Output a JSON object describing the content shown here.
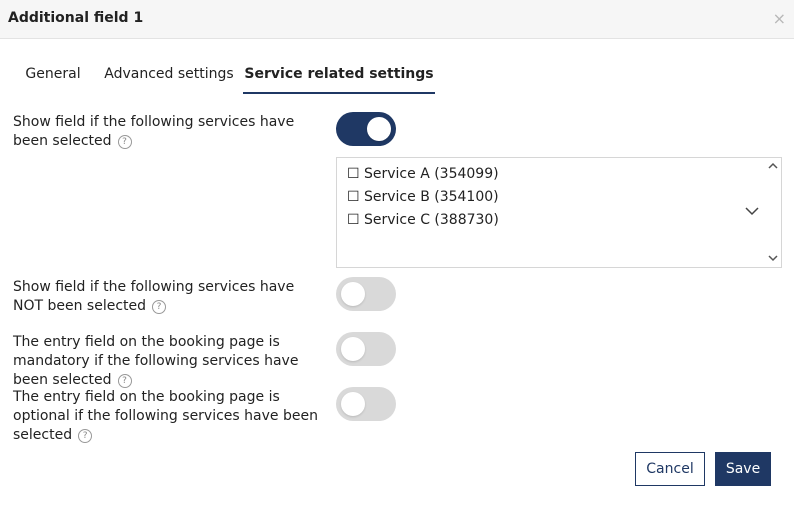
{
  "dialog": {
    "title": "Additional field 1",
    "close_icon": "×"
  },
  "tabs": [
    {
      "label": "General",
      "active": false
    },
    {
      "label": "Advanced settings",
      "active": false
    },
    {
      "label": "Service related settings",
      "active": true
    }
  ],
  "settings": [
    {
      "label": "Show field if the following services have been selected",
      "help": "?",
      "toggle_on": true
    },
    {
      "label": "Show field if the following services have NOT been selected",
      "help": "?",
      "toggle_on": false
    },
    {
      "label": "The entry field on the booking page is mandatory if the following services have been selected",
      "help": "?",
      "toggle_on": false
    },
    {
      "label": "The entry field on the booking page is optional if the following services have been selected",
      "help": "?",
      "toggle_on": false
    }
  ],
  "services": [
    {
      "label": "☐ Service A (354099)"
    },
    {
      "label": "☐ Service B (354100)"
    },
    {
      "label": "☐ Service C (388730)"
    }
  ],
  "buttons": {
    "cancel": "Cancel",
    "save": "Save"
  },
  "colors": {
    "accent": "#1f3864",
    "toggle_off": "#d9d9d9"
  }
}
